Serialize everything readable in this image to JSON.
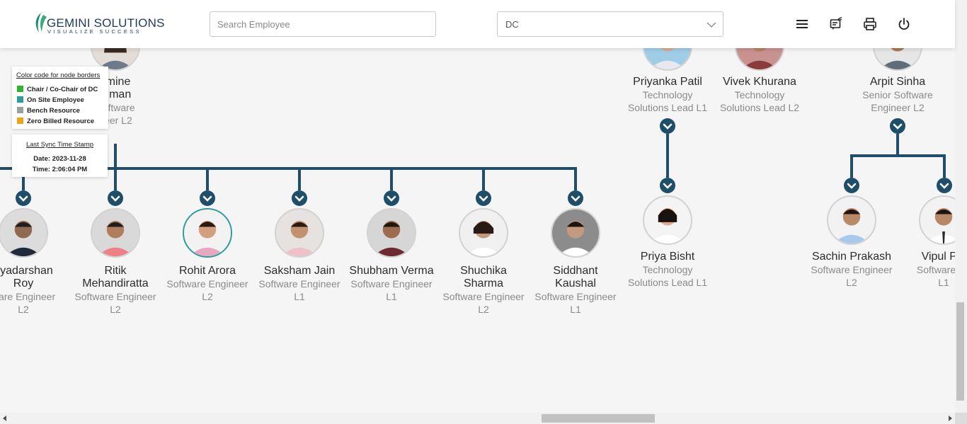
{
  "header": {
    "logo": {
      "brand": "GEMINI SOLUTIONS",
      "tagline": "VISUALIZE SUCCESS"
    },
    "search": {
      "placeholder": "Search Employee",
      "value": ""
    },
    "department_select": {
      "value": "DC"
    },
    "icons": [
      "menu-icon",
      "feedback-icon",
      "print-icon",
      "power-icon"
    ]
  },
  "legend": {
    "title": "Color code for node borders",
    "items": [
      {
        "label": "Chair / Co-Chair of DC",
        "color": "#2db52d"
      },
      {
        "label": "On Site Employee",
        "color": "#2c9c9c"
      },
      {
        "label": "Bench Resource",
        "color": "#9e9e9e"
      },
      {
        "label": "Zero Billed Resource",
        "color": "#f0a019"
      }
    ]
  },
  "sync": {
    "title": "Last Sync Time Stamp",
    "date": "Date: 2023-11-28",
    "time": "Time: 2:06:04 PM"
  },
  "colors": {
    "connector": "#1f4e6b",
    "expander": "#1f4e6b"
  },
  "top_nodes": [
    {
      "name_lines": [
        "smine",
        "mman"
      ],
      "role_lines": [
        "Software",
        "neer L2"
      ]
    },
    {
      "name_lines": [
        "Priyanka Patil"
      ],
      "role_lines": [
        "Technology",
        "Solutions Lead L1"
      ]
    },
    {
      "name_lines": [
        "Vivek Khurana"
      ],
      "role_lines": [
        "Technology",
        "Solutions Lead L2"
      ]
    },
    {
      "name_lines": [
        "Arpit Sinha"
      ],
      "role_lines": [
        "Senior Software",
        "Engineer L2"
      ]
    }
  ],
  "row_nodes": [
    {
      "name_lines": [
        "riyadarshan",
        "Roy"
      ],
      "role_lines": [
        "ware Engineer",
        "L2"
      ]
    },
    {
      "name_lines": [
        "Ritik",
        "Mehandiratta"
      ],
      "role_lines": [
        "Software Engineer",
        "L2"
      ]
    },
    {
      "name_lines": [
        "Rohit Arora"
      ],
      "role_lines": [
        "Software Engineer",
        "L2"
      ]
    },
    {
      "name_lines": [
        "Saksham Jain"
      ],
      "role_lines": [
        "Software Engineer",
        "L1"
      ]
    },
    {
      "name_lines": [
        "Shubham Verma"
      ],
      "role_lines": [
        "Software Engineer",
        "L1"
      ]
    },
    {
      "name_lines": [
        "Shuchika",
        "Sharma"
      ],
      "role_lines": [
        "Software Engineer",
        "L2"
      ]
    },
    {
      "name_lines": [
        "Siddhant",
        "Kaushal"
      ],
      "role_lines": [
        "Software Engineer",
        "L1"
      ]
    }
  ],
  "right_nodes": [
    {
      "name_lines": [
        "Priya Bisht"
      ],
      "role_lines": [
        "Technology",
        "Solutions Lead L1"
      ]
    },
    {
      "name_lines": [
        "Sachin Prakash"
      ],
      "role_lines": [
        "Software Engineer",
        "L2"
      ]
    },
    {
      "name_lines": [
        "Vipul Pal"
      ],
      "role_lines": [
        "Software En",
        "L1"
      ]
    }
  ]
}
